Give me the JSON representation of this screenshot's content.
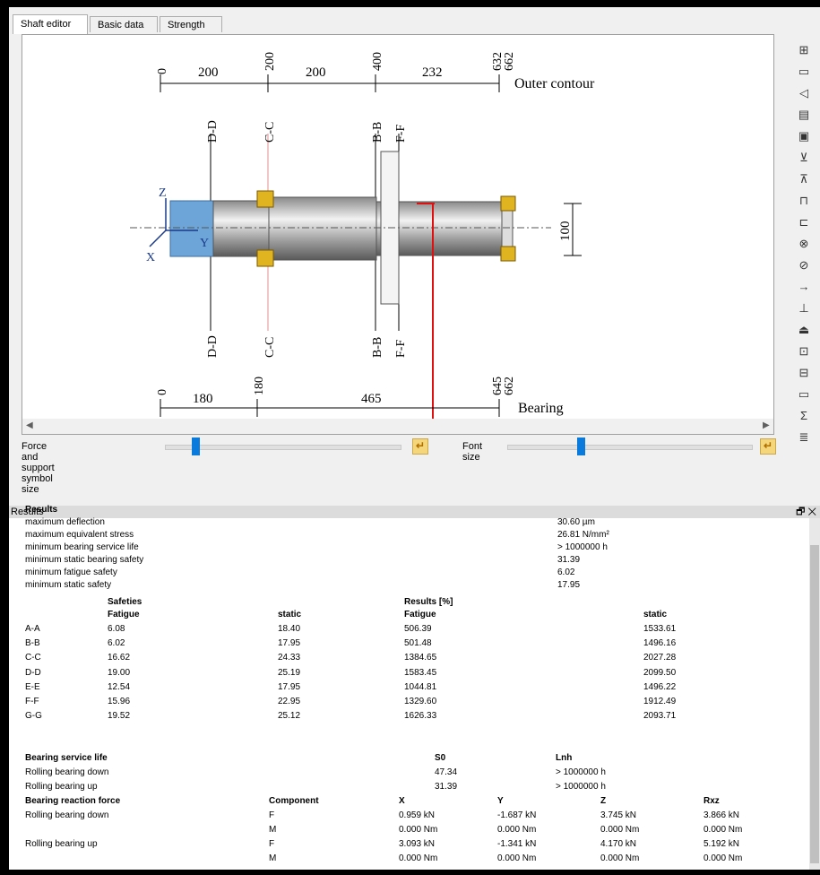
{
  "tabs": [
    "Shaft editor",
    "Basic data",
    "Strength"
  ],
  "editor": {
    "outer_contour_label": "Outer contour",
    "bearing_label": "Bearing",
    "top_dims": [
      "200",
      "200",
      "232"
    ],
    "top_ticks": [
      "0",
      "200",
      "400",
      "632",
      "662"
    ],
    "bottom_dims": [
      "180",
      "465"
    ],
    "bottom_ticks": [
      "0",
      "180",
      "645",
      "662"
    ],
    "diameter": "100",
    "section_labels_top": [
      "D-D",
      "C-C",
      "B-B",
      "F-F"
    ],
    "section_labels_bottom": [
      "D-D",
      "C-C",
      "B-B",
      "F-F"
    ],
    "axis_labels": {
      "z": "Z",
      "y": "Y",
      "x": "X"
    }
  },
  "sliders": {
    "symbol_size_label": "Force and support symbol size",
    "font_size_label": "Font size",
    "enter_glyph": "↵"
  },
  "results_panel": {
    "title": "Results",
    "pin_glyph": "🗗 ✕",
    "summary_header": "Results",
    "summary": [
      {
        "label": "maximum deflection",
        "value": "30.60 µm"
      },
      {
        "label": "maximum equivalent stress",
        "value": "26.81 N/mm²"
      },
      {
        "label": "minimum bearing service life",
        "value": "> 1000000 h"
      },
      {
        "label": "minimum static bearing safety",
        "value": "31.39"
      },
      {
        "label": "minimum fatigue safety",
        "value": "6.02"
      },
      {
        "label": "minimum static safety",
        "value": "17.95"
      }
    ],
    "safeties": {
      "header1": "Safeties",
      "header2": "Results [%]",
      "col_fatigue": "Fatigue",
      "col_static": "static",
      "col_fatigue2": "Fatigue",
      "col_static2": "static",
      "rows": [
        [
          "A-A",
          "6.08",
          "18.40",
          "506.39",
          "1533.61"
        ],
        [
          "B-B",
          "6.02",
          "17.95",
          "501.48",
          "1496.16"
        ],
        [
          "C-C",
          "16.62",
          "24.33",
          "1384.65",
          "2027.28"
        ],
        [
          "D-D",
          "19.00",
          "25.19",
          "1583.45",
          "2099.50"
        ],
        [
          "E-E",
          "12.54",
          "17.95",
          "1044.81",
          "1496.22"
        ],
        [
          "F-F",
          "15.96",
          "22.95",
          "1329.60",
          "1912.49"
        ],
        [
          "G-G",
          "19.52",
          "25.12",
          "1626.33",
          "2093.71"
        ]
      ]
    },
    "service_life": {
      "header": "Bearing service life",
      "col_s0": "S0",
      "col_lnh": "Lnh",
      "rows": [
        [
          "Rolling bearing down",
          "47.34",
          "> 1000000 h"
        ],
        [
          "Rolling bearing up",
          "31.39",
          "> 1000000 h"
        ]
      ]
    },
    "reaction": {
      "header": "Bearing reaction force",
      "cols": [
        "Component",
        "X",
        "Y",
        "Z",
        "Rxz"
      ],
      "rows": [
        [
          "Rolling bearing down",
          "F",
          "0.959 kN",
          "-1.687 kN",
          "3.745 kN",
          "3.866 kN"
        ],
        [
          "",
          "M",
          "0.000 Nm",
          "0.000 Nm",
          "0.000 Nm",
          "0.000 Nm"
        ],
        [
          "Rolling bearing up",
          "F",
          "3.093 kN",
          "-1.341 kN",
          "4.170 kN",
          "5.192 kN"
        ],
        [
          "",
          "M",
          "0.000 Nm",
          "0.000 Nm",
          "0.000 Nm",
          "0.000 Nm"
        ]
      ]
    }
  },
  "toolbar_icons": [
    "cylinder-icon",
    "cylinder-2-icon",
    "cone-icon",
    "hollow-cylinder-icon",
    "hollow-cone-icon",
    "bearing-down-icon",
    "bearing-up-icon",
    "support-icon",
    "notch-icon",
    "groove-icon",
    "key-icon",
    "force-icon",
    "coupling-icon",
    "shoulder-icon",
    "gear-icon",
    "interference-icon",
    "thread-icon",
    "sigma-icon",
    "table-icon"
  ]
}
